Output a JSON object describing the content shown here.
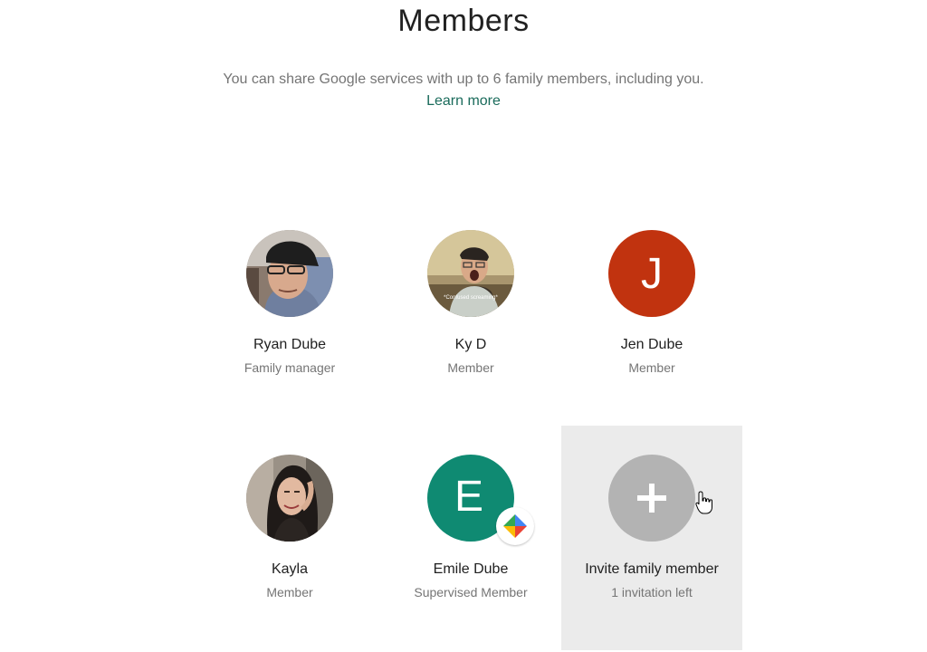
{
  "header": {
    "title": "Members",
    "subtitle": "You can share Google services with up to 6 family members, including you.",
    "learn_more": "Learn more"
  },
  "members": [
    {
      "name": "Ryan Dube",
      "role": "Family manager",
      "avatar": "photo"
    },
    {
      "name": "Ky D",
      "role": "Member",
      "avatar": "photo",
      "photo_caption": "*Confused screaming*"
    },
    {
      "name": "Jen Dube",
      "role": "Member",
      "avatar": "letter",
      "initial": "J",
      "color": "#c1330f"
    },
    {
      "name": "Kayla",
      "role": "Member",
      "avatar": "photo"
    },
    {
      "name": "Emile Dube",
      "role": "Supervised Member",
      "avatar": "letter",
      "initial": "E",
      "color": "#0f8a72",
      "badge": "family-link-icon"
    }
  ],
  "invite": {
    "label": "Invite family member",
    "status": "1 invitation left",
    "icon": "plus-icon",
    "icon_bg": "#b3b3b3"
  }
}
